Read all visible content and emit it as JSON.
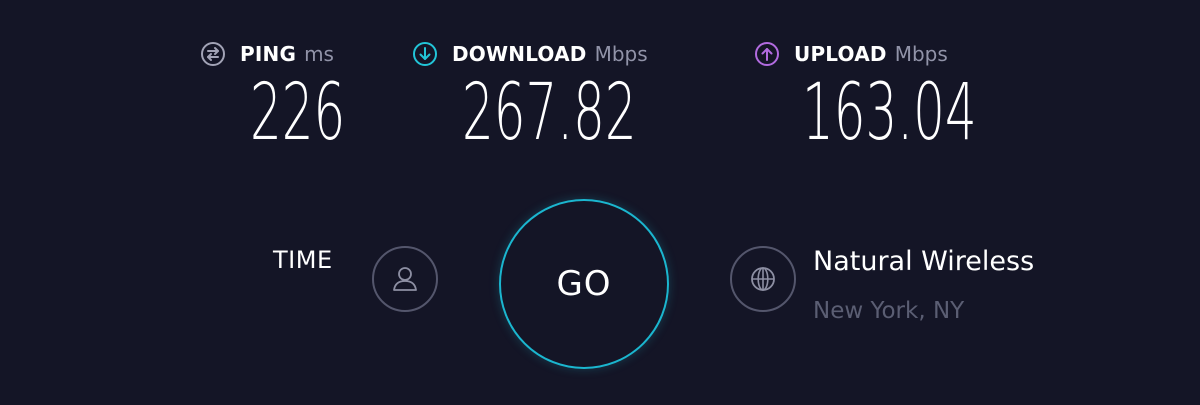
{
  "metrics": {
    "ping": {
      "label": "PING",
      "unit": "ms",
      "value": "226",
      "icon": "ping-icon",
      "color": "#a2a3b6"
    },
    "download": {
      "label": "DOWNLOAD",
      "unit": "Mbps",
      "value": "267.82",
      "icon": "download-arrow-icon",
      "color": "#22c5d8"
    },
    "upload": {
      "label": "UPLOAD",
      "unit": "Mbps",
      "value": "163.04",
      "icon": "upload-arrow-icon",
      "color": "#b26be0"
    }
  },
  "controls": {
    "time_label": "TIME",
    "go_label": "GO",
    "go_color": "#1bb6cf",
    "profile_icon": "user-icon"
  },
  "provider": {
    "name": "Natural Wireless",
    "location": "New York, NY",
    "icon": "globe-icon"
  },
  "theme": {
    "background": "#141526",
    "unit_color": "#9193a8",
    "muted_text": "#5b5e73"
  }
}
